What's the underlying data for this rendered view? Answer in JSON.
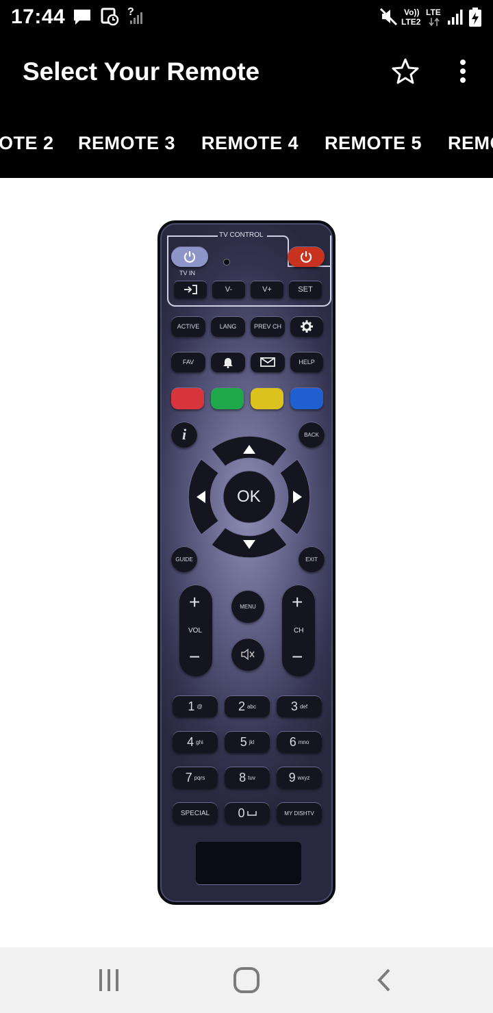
{
  "status_bar": {
    "time": "17:44",
    "question_mark": "?",
    "volte_label": "Vo))",
    "lte2_label": "LTE2",
    "lte_label": "LTE",
    "icons": [
      "chat-icon",
      "alarm-icon",
      "signal-weak-icon",
      "mute-icon",
      "signal-icon",
      "battery-charging-icon"
    ]
  },
  "app_bar": {
    "title": "Select Your Remote",
    "icons": [
      "star-outline-icon",
      "more-vert-icon"
    ]
  },
  "tabs": [
    "OTE 2",
    "REMOTE 3",
    "REMOTE 4",
    "REMOTE 5",
    "REMO"
  ],
  "remote": {
    "tv_control": "TV CONTROL",
    "tv_in": "TV IN",
    "row1": [
      "V-",
      "V+",
      "SET"
    ],
    "row2": [
      "ACTIVE",
      "LANG",
      "PREV CH"
    ],
    "row3_left": "FAV",
    "row3_right": "HELP",
    "info": "i",
    "back": "BACK",
    "ok": "OK",
    "guide": "GUIDE",
    "exit": "EXIT",
    "menu": "MENU",
    "vol": "VOL",
    "ch": "CH",
    "plus": "+",
    "minus": "−",
    "digits": [
      {
        "n": "1",
        "s": "@"
      },
      {
        "n": "2",
        "s": "abc"
      },
      {
        "n": "3",
        "s": "def"
      },
      {
        "n": "4",
        "s": "ghi"
      },
      {
        "n": "5",
        "s": "jkl"
      },
      {
        "n": "6",
        "s": "mno"
      },
      {
        "n": "7",
        "s": "pqrs"
      },
      {
        "n": "8",
        "s": "tuv"
      },
      {
        "n": "9",
        "s": "wxyz"
      }
    ],
    "special": "SPECIAL",
    "zero": "0",
    "mydishtv": "MY DISHTV",
    "colors": [
      "#d8343b",
      "#1fa84a",
      "#dcc21c",
      "#1f5fd0"
    ],
    "power_tv_color": "#8e95c8",
    "power_color": "#c8321f"
  },
  "nav_bar": {
    "icons": [
      "recents-icon",
      "home-icon",
      "back-icon"
    ]
  }
}
